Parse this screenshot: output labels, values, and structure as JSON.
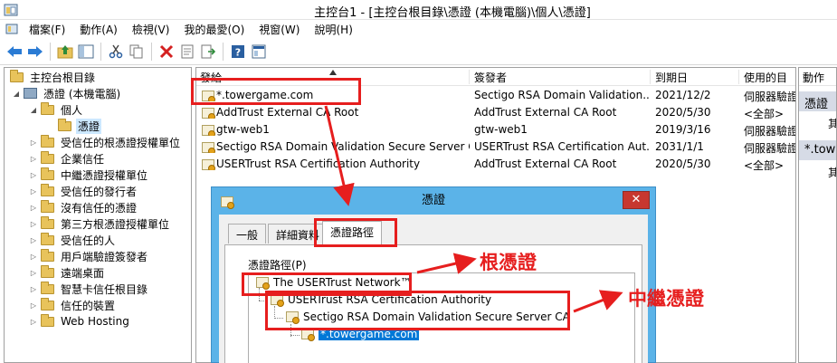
{
  "window": {
    "title": "主控台1 - [主控台根目錄\\憑證 (本機電腦)\\個人\\憑證]"
  },
  "menu": [
    "檔案(F)",
    "動作(A)",
    "檢視(V)",
    "我的最愛(O)",
    "視窗(W)",
    "說明(H)"
  ],
  "toolbar_icons": [
    "back-icon",
    "forward-icon",
    "up-folder-icon",
    "show-hide-tree-icon",
    "cut-icon",
    "copy-icon",
    "delete-icon",
    "properties-icon",
    "export-icon",
    "help-icon",
    "view-icon"
  ],
  "tree": {
    "root": "主控台根目錄",
    "store": "憑證 (本機電腦)",
    "personal": "個人",
    "certs": "憑證",
    "folders": [
      "受信任的根憑證授權單位",
      "企業信任",
      "中繼憑證授權單位",
      "受信任的發行者",
      "沒有信任的憑證",
      "第三方根憑證授權單位",
      "受信任的人",
      "用戶端驗證簽發者",
      "遠端桌面",
      "智慧卡信任根目錄",
      "信任的裝置",
      "Web Hosting"
    ]
  },
  "list": {
    "columns": [
      "發給",
      "簽發者",
      "到期日",
      "使用的目"
    ],
    "rows": [
      {
        "subject": "*.towergame.com",
        "issuer": "Sectigo RSA Domain Validation...",
        "expires": "2021/12/2",
        "purpose": "伺服器驗證"
      },
      {
        "subject": "AddTrust External CA Root",
        "issuer": "AddTrust External CA Root",
        "expires": "2020/5/30",
        "purpose": "<全部>"
      },
      {
        "subject": "gtw-web1",
        "issuer": "gtw-web1",
        "expires": "2019/3/16",
        "purpose": "伺服器驗證"
      },
      {
        "subject": "Sectigo RSA Domain Validation Secure Server CA",
        "issuer": "USERTrust RSA Certification Aut...",
        "expires": "2031/1/1",
        "purpose": "伺服器驗證"
      },
      {
        "subject": "USERTrust RSA Certification Authority",
        "issuer": "AddTrust External CA Root",
        "expires": "2020/5/30",
        "purpose": "<全部>"
      }
    ]
  },
  "actions": {
    "header": "動作",
    "group1": "憑證",
    "group1_item": "其",
    "group2": "*.tower",
    "group2_item": "其"
  },
  "dialog": {
    "title": "憑證",
    "close": "✕",
    "tabs": [
      "一般",
      "詳細資料",
      "憑證路徑"
    ],
    "path_label": "憑證路徑(P)",
    "path": [
      "The USERTrust Network™",
      "USERTrust RSA Certification Authority",
      "Sectigo RSA Domain Validation Secure Server CA",
      "*.towergame.com"
    ]
  },
  "annotations": {
    "root": "根憑證",
    "intermediate": "中繼憑證",
    "color": "#e61e1e"
  }
}
